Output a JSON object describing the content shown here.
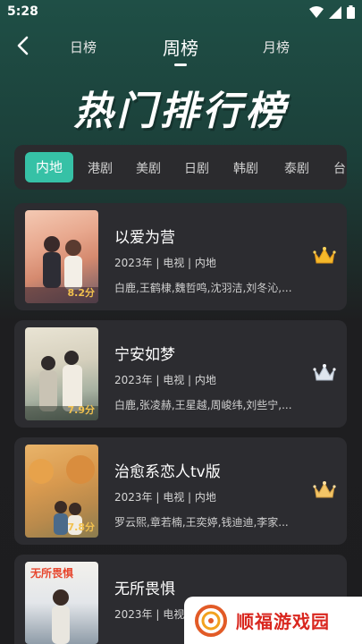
{
  "status_bar": {
    "time": "5:28"
  },
  "nav": {
    "tabs": [
      {
        "label": "日榜",
        "active": false
      },
      {
        "label": "周榜",
        "active": true
      },
      {
        "label": "月榜",
        "active": false
      }
    ]
  },
  "hero": {
    "title": "热门排行榜"
  },
  "categories": [
    "内地",
    "港剧",
    "美剧",
    "日剧",
    "韩剧",
    "泰剧",
    "台"
  ],
  "selected_category": "内地",
  "accent_color": "#36c1a6",
  "items": [
    {
      "title": "以爱为营",
      "meta": "2023年 | 电视 | 内地",
      "cast": "白鹿,王鹤棣,魏哲鸣,沈羽洁,刘冬沁,...",
      "score": "8.2分",
      "crown": "gold-crown-icon"
    },
    {
      "title": "宁安如梦",
      "meta": "2023年 | 电视 | 内地",
      "cast": "白鹿,张凌赫,王星越,周峻纬,刘些宁,...",
      "score": "7.9分",
      "crown": "silver-crown-icon"
    },
    {
      "title": "治愈系恋人tv版",
      "meta": "2023年 | 电视 | 内地",
      "cast": "罗云熙,章若楠,王奕婷,钱迪迪,李家...",
      "score": "7.8分",
      "crown": "bronze-crown-icon"
    },
    {
      "title": "无所畏惧",
      "meta": "2023年 | 电视",
      "poster_text": "无所畏惧"
    }
  ],
  "watermark": {
    "text": "顺福游戏园"
  }
}
